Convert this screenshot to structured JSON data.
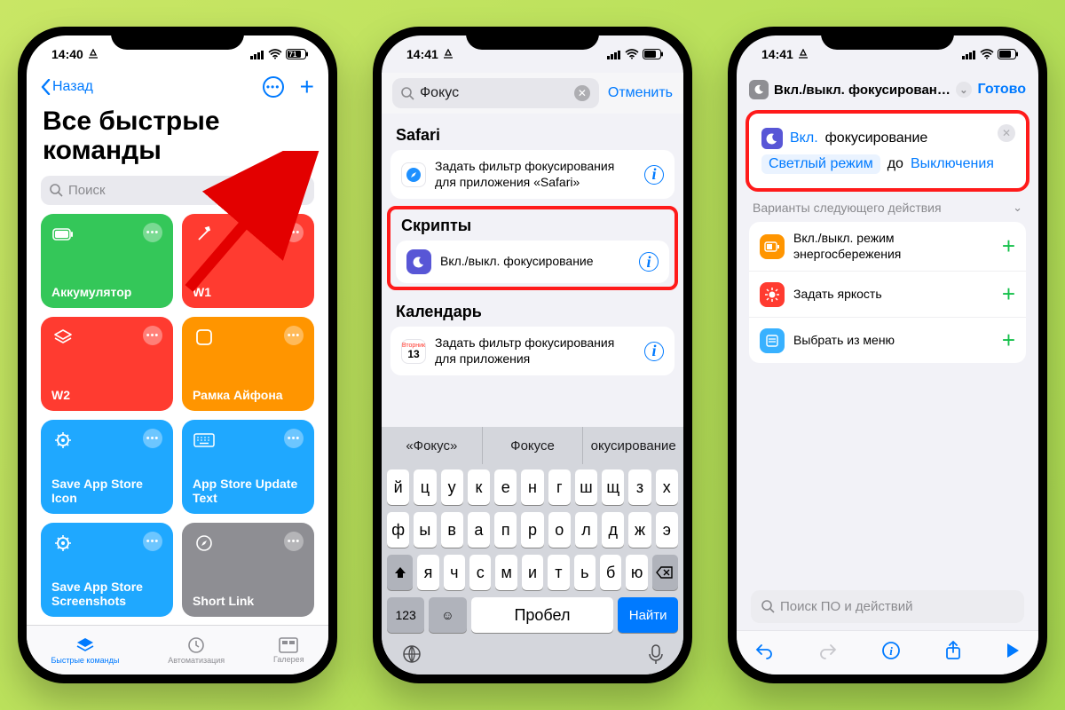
{
  "status": {
    "time1": "14:40",
    "time2": "14:41",
    "time3": "14:41",
    "battery": "71"
  },
  "p1": {
    "back": "Назад",
    "title": "Все быстрые команды",
    "search_ph": "Поиск",
    "tiles": [
      {
        "name": "Аккумулятор",
        "color": "#34c759"
      },
      {
        "name": "W1",
        "color": "#ff3b30"
      },
      {
        "name": "W2",
        "color": "#ff3b30"
      },
      {
        "name": "Рамка Айфона",
        "color": "#ff9500"
      },
      {
        "name": "Save App Store Icon",
        "color": "#1fa8ff"
      },
      {
        "name": "App Store Update Text",
        "color": "#1fa8ff"
      },
      {
        "name": "Save App Store Screenshots",
        "color": "#1fa8ff"
      },
      {
        "name": "Short Link",
        "color": "#8e8e93"
      }
    ],
    "tabs": [
      "Быстрые команды",
      "Автоматизация",
      "Галерея"
    ]
  },
  "p2": {
    "search_value": "Фокус",
    "cancel": "Отменить",
    "sections": {
      "safari": {
        "label": "Safari",
        "row": "Задать фильтр фокусирования для приложения «Safari»"
      },
      "scripts": {
        "label": "Скрипты",
        "row": "Вкл./выкл. фокусирование"
      },
      "calendar": {
        "label": "Календарь",
        "row": "Задать фильтр фокусирования для приложения",
        "day_label": "Вторник",
        "day": "13"
      }
    },
    "suggestions": [
      "«Фокус»",
      "Фокусе",
      "окусирование"
    ],
    "keys_r1": [
      "й",
      "ц",
      "у",
      "к",
      "е",
      "н",
      "г",
      "ш",
      "щ",
      "з",
      "х"
    ],
    "keys_r2": [
      "ф",
      "ы",
      "в",
      "а",
      "п",
      "р",
      "о",
      "л",
      "д",
      "ж",
      "э"
    ],
    "keys_r3": [
      "я",
      "ч",
      "с",
      "м",
      "и",
      "т",
      "ь",
      "б",
      "ю"
    ],
    "key_123": "123",
    "key_space": "Пробел",
    "key_find": "Найти"
  },
  "p3": {
    "title": "Вкл./выкл. фокусирован…",
    "done": "Готово",
    "action": {
      "tok1": "Вкл.",
      "tok2": "фокусирование",
      "tok3": "Светлый режим",
      "tok4": "до",
      "tok5": "Выключения"
    },
    "sugg_header": "Варианты следующего действия",
    "suggestions": [
      {
        "label": "Вкл./выкл. режим энергосбережения",
        "color": "#ff9500"
      },
      {
        "label": "Задать яркость",
        "color": "#ff3b30"
      },
      {
        "label": "Выбрать из меню",
        "color": "#38b1ff"
      }
    ],
    "search_ph": "Поиск ПО и действий"
  }
}
